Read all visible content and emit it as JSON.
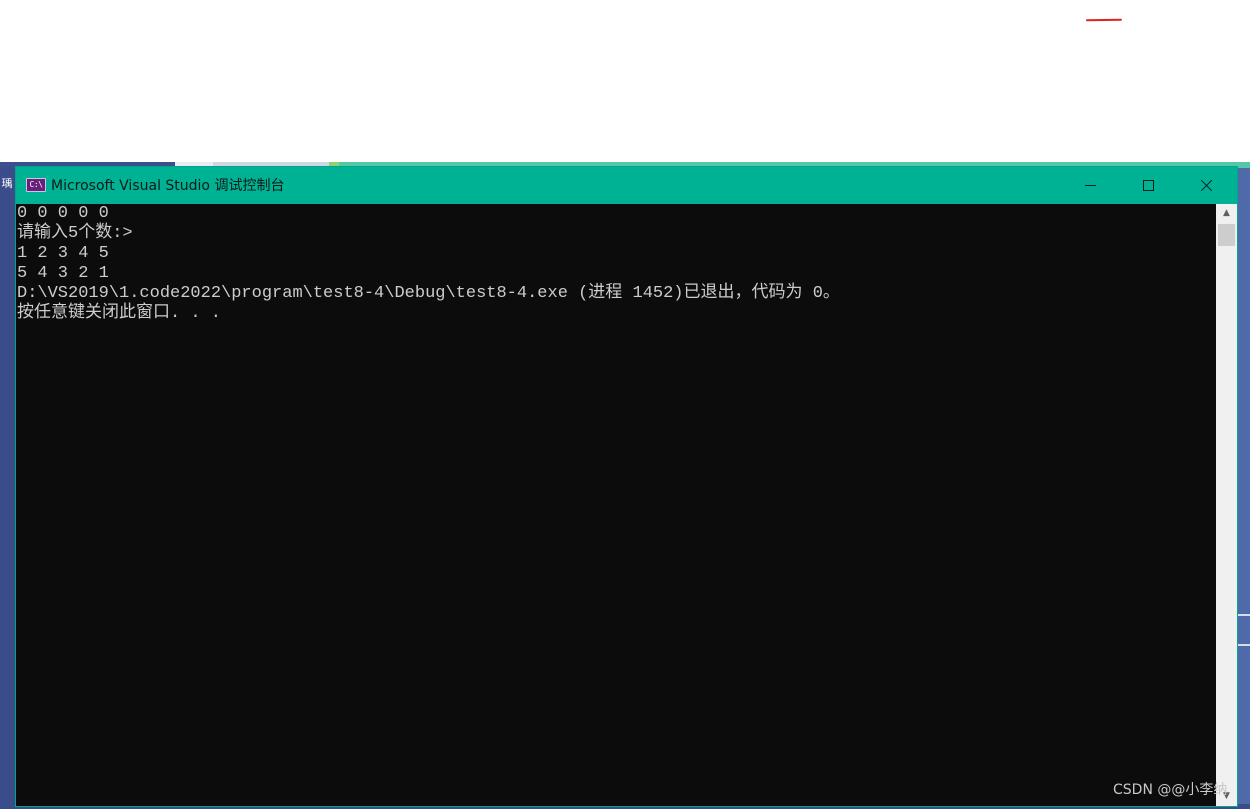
{
  "window": {
    "title": "Microsoft Visual Studio 调试控制台",
    "app_icon": "console-app-icon",
    "app_icon_text": "C:\\",
    "controls": {
      "minimize_icon": "minimize-icon",
      "maximize_icon": "maximize-icon",
      "close_icon": "close-icon"
    },
    "titlebar_color": "#00b294",
    "console_background": "#0c0c0c",
    "console_text_color": "#cccccc"
  },
  "console": {
    "lines": [
      "0 0 0 0 0",
      "请输入5个数:>",
      "1 2 3 4 5",
      "5 4 3 2 1",
      "D:\\VS2019\\1.code2022\\program\\test8-4\\Debug\\test8-4.exe (进程 1452)已退出，代码为 0。",
      "按任意键关闭此窗口. . ."
    ]
  },
  "scrollbar": {
    "up_icon": "scroll-up-arrow-icon",
    "down_icon": "scroll-down-arrow-icon",
    "up_glyph": "▲",
    "down_glyph": "▼"
  },
  "background": {
    "left_edge_glyph": "瑀"
  },
  "watermark": {
    "text": "CSDN @@小李纳"
  }
}
